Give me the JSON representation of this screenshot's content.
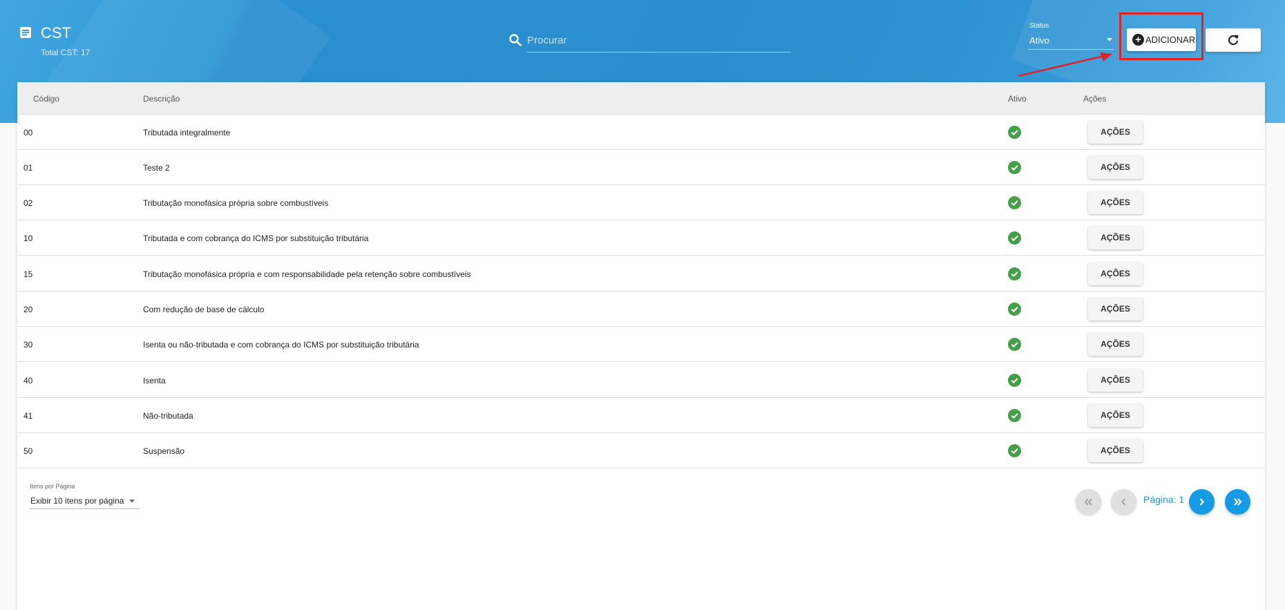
{
  "header": {
    "title": "CST",
    "subtitle": "Total CST: 17",
    "search_placeholder": "Procurar",
    "status_label": "Status",
    "status_value": "Ativo",
    "add_label": "ADICIONAR",
    "icons": [
      "document-icon",
      "search-icon",
      "plus-circle-icon",
      "refresh-icon"
    ]
  },
  "table": {
    "columns": [
      "Código",
      "Descrição",
      "Ativo",
      "Ações"
    ],
    "actions_label": "AÇÕES",
    "rows": [
      {
        "codigo": "00",
        "descricao": "Tributada integralmente",
        "ativo": true
      },
      {
        "codigo": "01",
        "descricao": "Teste 2",
        "ativo": true
      },
      {
        "codigo": "02",
        "descricao": "Tributação monofásica própria sobre combustíveis",
        "ativo": true
      },
      {
        "codigo": "10",
        "descricao": "Tributada e com cobrança do ICMS por substituição tributária",
        "ativo": true
      },
      {
        "codigo": "15",
        "descricao": "Tributação monofásica própria e com responsabilidade pela retenção sobre combustíveis",
        "ativo": true
      },
      {
        "codigo": "20",
        "descricao": "Com redução de base de cálculo",
        "ativo": true
      },
      {
        "codigo": "30",
        "descricao": "Isenta ou não-tributada e com cobrança do ICMS por substituição tributária",
        "ativo": true
      },
      {
        "codigo": "40",
        "descricao": "Isenta",
        "ativo": true
      },
      {
        "codigo": "41",
        "descricao": "Não-tributada",
        "ativo": true
      },
      {
        "codigo": "50",
        "descricao": "Suspensão",
        "ativo": true
      }
    ]
  },
  "pagination": {
    "items_per_page_label": "Itens por Página",
    "items_per_page_value": "Exibir 10 itens por página",
    "page_label": "Página: 1"
  },
  "colors": {
    "header_blue": "#2c8dcc",
    "accent": "#139ce5",
    "check_green": "#43a047",
    "highlight_red": "#e32222"
  }
}
